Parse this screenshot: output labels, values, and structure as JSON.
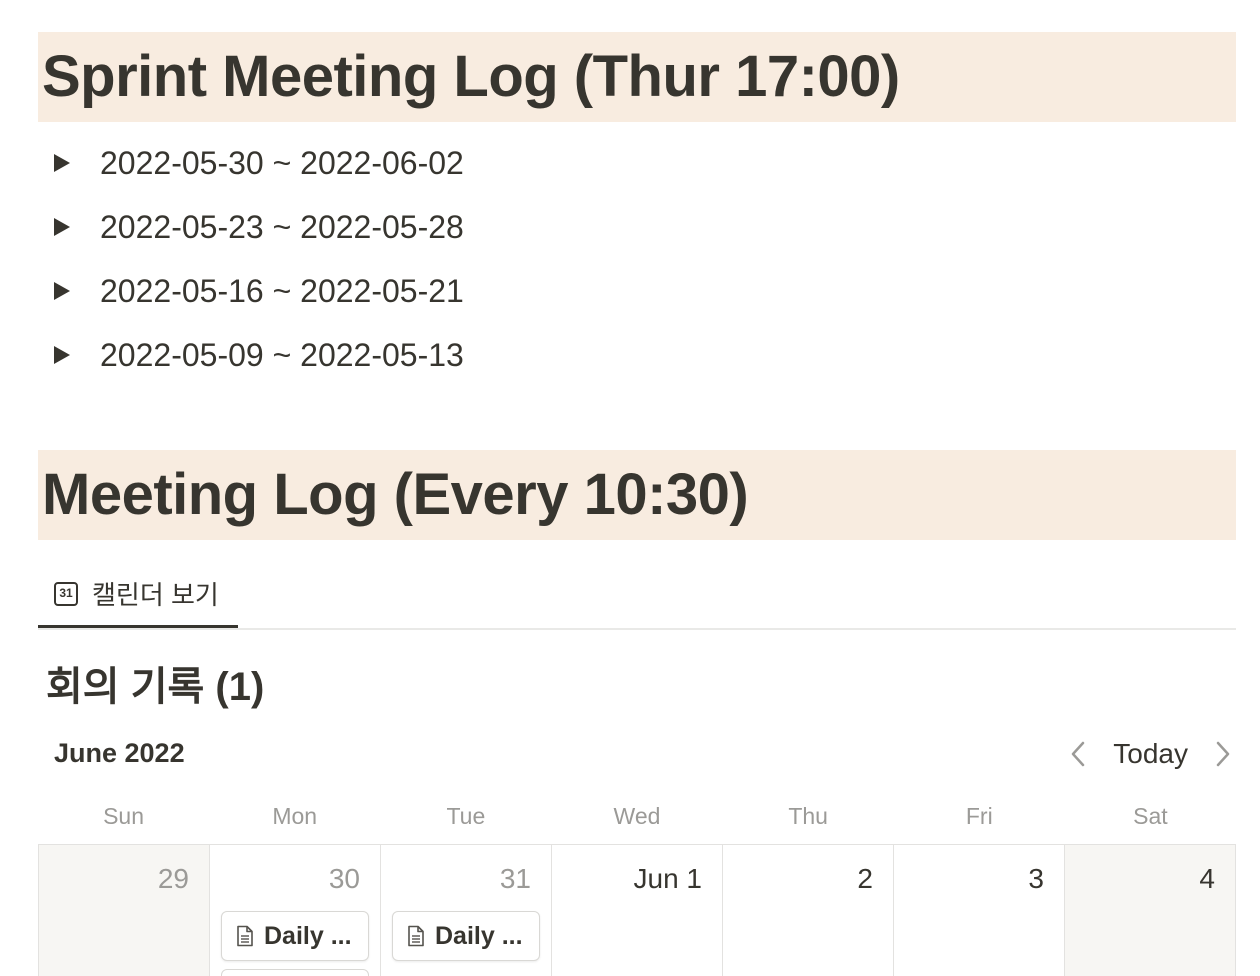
{
  "sections": [
    {
      "title": "Sprint Meeting Log (Thur 17:00)"
    },
    {
      "title": "Meeting Log (Every 10:30)"
    }
  ],
  "toggles": [
    "2022-05-30 ~ 2022-06-02",
    "2022-05-23 ~ 2022-05-28",
    "2022-05-16 ~ 2022-05-21",
    "2022-05-09 ~ 2022-05-13"
  ],
  "view_tab": {
    "icon": "calendar-icon",
    "icon_number": "31",
    "label": "캘린더 보기"
  },
  "database": {
    "title": "회의 기록 (1)"
  },
  "calendar": {
    "month": "June 2022",
    "today_label": "Today",
    "weekdays": [
      "Sun",
      "Mon",
      "Tue",
      "Wed",
      "Thu",
      "Fri",
      "Sat"
    ],
    "days": [
      {
        "label": "29",
        "muted": true,
        "weekend": true,
        "card": ""
      },
      {
        "label": "30",
        "muted": true,
        "weekend": false,
        "card": "Daily ..."
      },
      {
        "label": "31",
        "muted": true,
        "weekend": false,
        "card": "Daily ..."
      },
      {
        "label": "Jun 1",
        "muted": false,
        "weekend": false,
        "card": ""
      },
      {
        "label": "2",
        "muted": false,
        "weekend": false,
        "card": ""
      },
      {
        "label": "3",
        "muted": false,
        "weekend": false,
        "card": ""
      },
      {
        "label": "4",
        "muted": false,
        "weekend": true,
        "card": ""
      }
    ]
  },
  "colors": {
    "heading_bg": "#f8ece0",
    "text": "#37352f",
    "muted_text": "#9b9a97",
    "weekend_bg": "#f7f6f3"
  }
}
